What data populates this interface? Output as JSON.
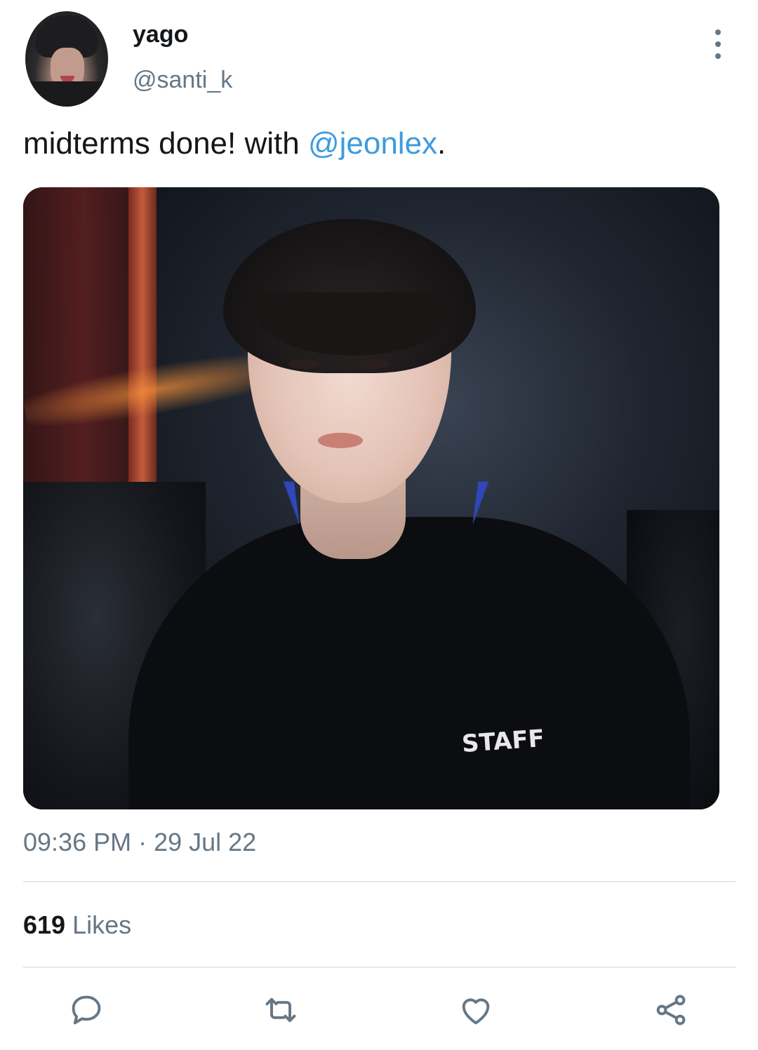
{
  "user": {
    "display_name": "yago",
    "handle": "@santi_k"
  },
  "tweet": {
    "text_prefix": "midterms done! with ",
    "mention": "@jeonlex",
    "text_suffix": ".",
    "media_shirt_text": "STAFF",
    "timestamp": "09:36 PM · 29 Jul 22"
  },
  "stats": {
    "likes_count": "619",
    "likes_label": "Likes"
  },
  "actions": {
    "reply_icon": "comment-icon",
    "retweet_icon": "retweet-icon",
    "like_icon": "heart-icon",
    "share_icon": "share-icon"
  },
  "colors": {
    "mention": "#3d9be0",
    "secondary_text": "#657786",
    "primary_text": "#14171a"
  }
}
